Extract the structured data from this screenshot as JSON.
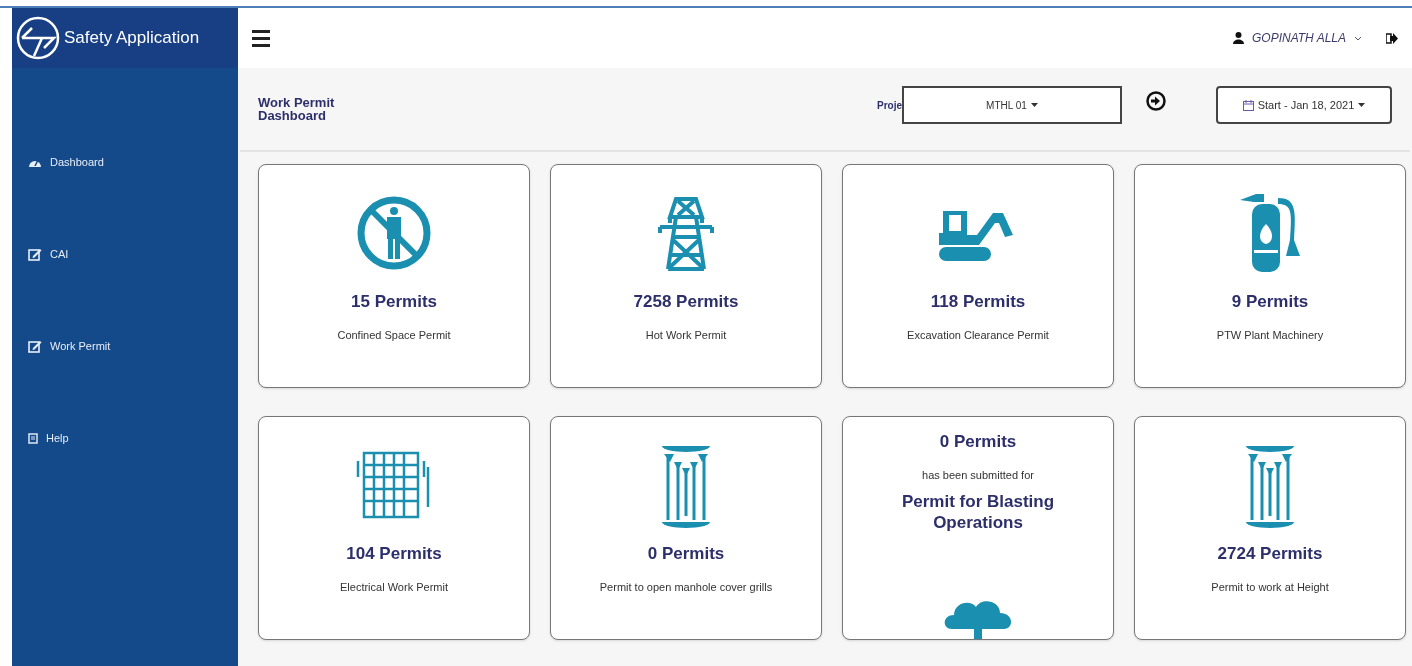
{
  "app": {
    "title": "Safety Application"
  },
  "sidebar": {
    "items": [
      {
        "label": "Dashboard"
      },
      {
        "label": "CAI"
      },
      {
        "label": "Work Permit"
      },
      {
        "label": "Help"
      }
    ]
  },
  "header": {
    "user": "GOPINATH ALLA"
  },
  "page": {
    "title": "Work Permit Dashboard",
    "project_label": "Proje",
    "project": "MTHL 01",
    "date": "Start - Jan 18, 2021"
  },
  "cards": [
    {
      "kind": "standard",
      "count": "15 Permits",
      "label": "Confined Space Permit"
    },
    {
      "kind": "standard",
      "count": "7258 Permits",
      "label": "Hot Work Permit"
    },
    {
      "kind": "standard",
      "count": "118 Permits",
      "label": "Excavation Clearance Permit"
    },
    {
      "kind": "standard",
      "count": "9 Permits",
      "label": "PTW Plant Machinery"
    },
    {
      "kind": "standard",
      "count": "104 Permits",
      "label": "Electrical Work Permit"
    },
    {
      "kind": "standard",
      "count": "0 Permits",
      "label": "Permit to open manhole cover grills"
    },
    {
      "kind": "submitted",
      "count": "0 Permits",
      "note": "has been submitted for",
      "label": "Permit for Blasting Operations"
    },
    {
      "kind": "standard",
      "count": "2724 Permits",
      "label": "Permit to work at Height"
    }
  ]
}
